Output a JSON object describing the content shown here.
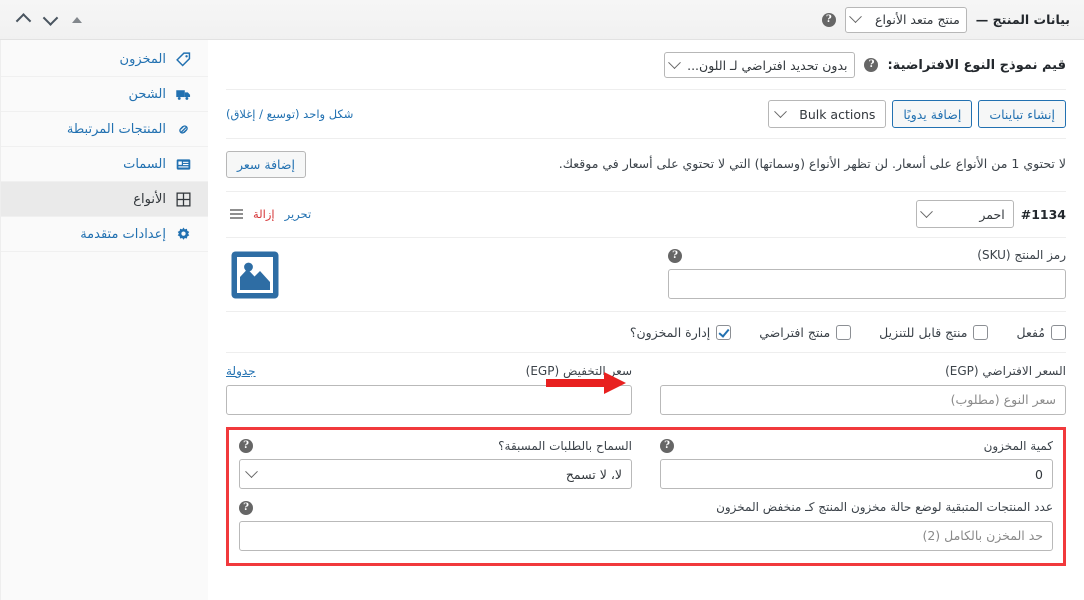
{
  "topbar": {
    "title": "بيانات المنتج — ",
    "product_type": "منتج متعد الأنواع",
    "help_icon": "help-icon",
    "nav_up_icon": "triangle-up-icon",
    "nav_down_icon": "chevron-down-icon",
    "nav_collapse_icon": "chevron-up-icon"
  },
  "sidebar": {
    "items": [
      {
        "label": "المخزون",
        "icon": "tag-icon",
        "active": false
      },
      {
        "label": "الشحن",
        "icon": "truck-icon",
        "active": false
      },
      {
        "label": "المنتجات المرتبطة",
        "icon": "link-icon",
        "active": false
      },
      {
        "label": "السمات",
        "icon": "list-box-icon",
        "active": false
      },
      {
        "label": "الأنواع",
        "icon": "grid-icon",
        "active": true
      },
      {
        "label": "إعدادات متقدمة",
        "icon": "gear-icon",
        "active": false
      }
    ]
  },
  "defaults_row": {
    "label": "قيم نموذج النوع الافتراضية:",
    "help_icon": "help-icon",
    "select_value": "بدون تحديد افتراضي لـ اللون..."
  },
  "actions_row": {
    "generate_button": "إنشاء تباينات",
    "add_manually_button": "إضافة يدويًا",
    "bulk_actions_label": "Bulk actions",
    "expand_close_link": "شكل واحد (توسيع / إغلاق)"
  },
  "notice_row": {
    "text": "لا تحتوي 1 من الأنواع على أسعار. لن تظهر الأنواع (وسماتها) التي لا تحتوي على أسعار في موقعك.",
    "add_price_button": "إضافة سعر"
  },
  "variation": {
    "id": "#1134",
    "attribute_value": "احمر",
    "edit_link": "تحرير",
    "remove_link": "إزالة",
    "drag_handle_icon": "drag-handle-icon",
    "image_icon": "image-placeholder-icon",
    "sku": {
      "label": "رمز المنتج (SKU)",
      "value": "",
      "placeholder": "",
      "help_icon": "help-icon"
    },
    "checkboxes": [
      {
        "label": "مُفعل",
        "checked": false
      },
      {
        "label": "منتج قابل للتنزيل",
        "checked": false
      },
      {
        "label": "منتج افتراضي",
        "checked": false
      },
      {
        "label": "إدارة المخزون؟",
        "checked": true
      }
    ],
    "regular_price": {
      "label": "السعر الافتراضي (EGP)",
      "value": "",
      "placeholder": "سعر النوع (مطلوب)"
    },
    "sale_price": {
      "label": "سعر التخفيض (EGP)",
      "schedule_link": "جدولة",
      "value": "",
      "placeholder": ""
    },
    "stock_quantity": {
      "label": "كمية المخزون",
      "value": "0",
      "help_icon": "help-icon"
    },
    "backorders": {
      "label": "السماح بالطلبات المسبقة؟",
      "value": "لا، لا تسمح",
      "help_icon": "help-icon"
    },
    "low_stock_threshold": {
      "label": "عدد المنتجات المتبقية لوضع حالة مخزون المنتج كـ منخفض المخزون",
      "value": "",
      "placeholder": "حد المخزن بالكامل (2)",
      "help_icon": "help-icon"
    }
  },
  "annotation": {
    "arrow_icon": "red-arrow-icon",
    "highlight_color": "#f1393c"
  }
}
